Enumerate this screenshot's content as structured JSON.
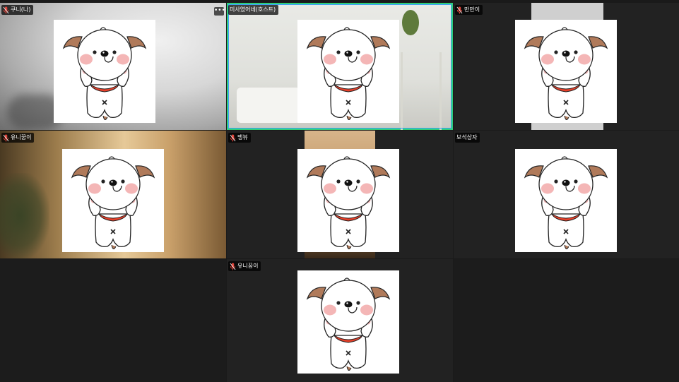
{
  "participants": [
    {
      "name": "쿠니(나)",
      "muted": true
    },
    {
      "name": "미사였어녜(호스트)",
      "muted": false
    },
    {
      "name": "만만이",
      "muted": true
    },
    {
      "name": "유니꿈이",
      "muted": true
    },
    {
      "name": "맹뷰",
      "muted": true
    },
    {
      "name": "보석상자",
      "muted": false
    },
    {
      "name": "유니꿈이",
      "muted": true
    }
  ],
  "more_options_label": "•••",
  "colors": {
    "active_border": "#2fd07a",
    "tile_bg": "#242424",
    "muted_mic": "#e0443a"
  },
  "icons": {
    "muted": "mic-muted-icon",
    "more": "more-options-icon"
  }
}
